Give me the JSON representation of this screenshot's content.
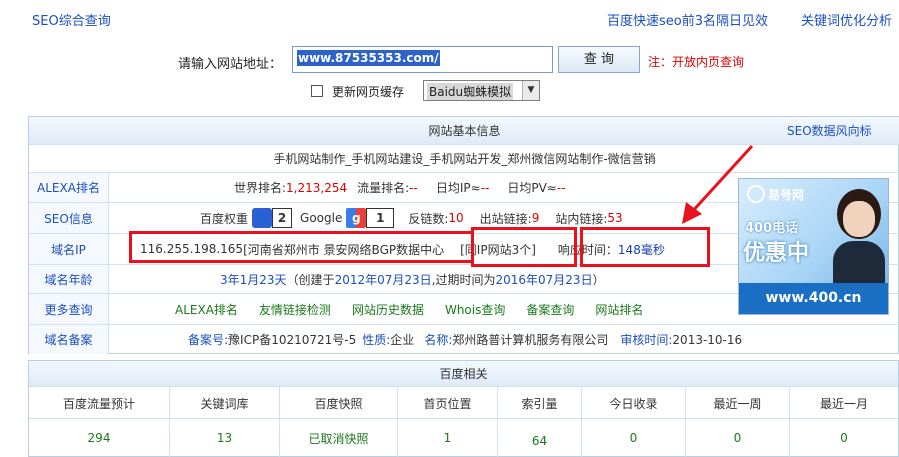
{
  "topbar": {
    "brand": "SEO综合查询",
    "ad_links": [
      "百度快速seo前3名隔日见效",
      "关键词优化分析"
    ]
  },
  "search": {
    "label": "请输入网站地址：",
    "url_value": "www.87535353.com/",
    "button": "查 询",
    "note": "注：开放内页查询",
    "refresh_cache_label": "更新网页缓存",
    "spider_select_value": "Baidu蜘蛛模拟"
  },
  "panel": {
    "title": "网站基本信息",
    "seo_trend_link": "SEO数据风向标",
    "site_title": "手机网站制作_手机网站建设_手机网站开发_郑州微信网站制作-微信营销",
    "alexa": {
      "label": "ALEXA排名",
      "world_rank_label": "世界排名:",
      "world_rank": "1,213,254",
      "traffic_rank_label": "流量排名:",
      "traffic_rank": "--",
      "daily_ip_label": "日均IP≈",
      "daily_ip": "--",
      "daily_pv_label": "日均PV≈",
      "daily_pv": "--"
    },
    "seo_info": {
      "label": "SEO信息",
      "baidu_weight_label": "百度权重",
      "baidu_weight": "2",
      "google_label": "Google",
      "google_pr": "1",
      "backlinks_label": "反链数:",
      "backlinks": "10",
      "outbound_label": "出站链接:",
      "outbound": "9",
      "inbound_label": "站内链接:",
      "inbound": "53"
    },
    "domain_ip": {
      "label": "域名IP",
      "ip": "116.255.198.165",
      "location": "[河南省郑州市 景安网络BGP数据中心",
      "same_ip": "[同IP网站3个]",
      "response_label": "响应时间：",
      "response_time": "148毫秒"
    },
    "domain_age": {
      "label": "域名年龄",
      "age": "3年1月23天",
      "created_prefix": "（创建于",
      "created": "2012年07月23日",
      "expires_prefix": ",过期时间为",
      "expires": "2016年07月23日",
      "suffix": "）"
    },
    "more_queries": {
      "label": "更多查询",
      "links": [
        "ALEXA排名",
        "友情链接检测",
        "网站历史数据",
        "Whois查询",
        "备案查询",
        "网站排名"
      ]
    },
    "icp": {
      "label": "域名备案",
      "number_label": "备案号:",
      "number": "豫ICP备10210721号-5",
      "nature_label": "性质:",
      "nature": "企业",
      "name_label": "名称:",
      "name": "郑州路普计算机服务有限公司",
      "audit_label": "审核时间:",
      "audit_time": "2013-10-16"
    }
  },
  "ad": {
    "brand": "易号网",
    "phone_promo": "400电话",
    "promo": "优惠中",
    "site": "www.400.cn"
  },
  "baidu_stats": {
    "title": "百度相关",
    "headers": [
      "百度流量预计",
      "关键词库",
      "百度快照",
      "首页位置",
      "索引量",
      "今日收录",
      "最近一周",
      "最近一月"
    ],
    "values": [
      "294",
      "13",
      "已取消快照",
      "1",
      "64",
      "0",
      "0",
      "0"
    ]
  },
  "colors": {
    "link_blue": "#1a4fbf",
    "highlight_red": "#e8111d",
    "value_red": "#dd0000",
    "value_green": "#1a7a1a"
  }
}
